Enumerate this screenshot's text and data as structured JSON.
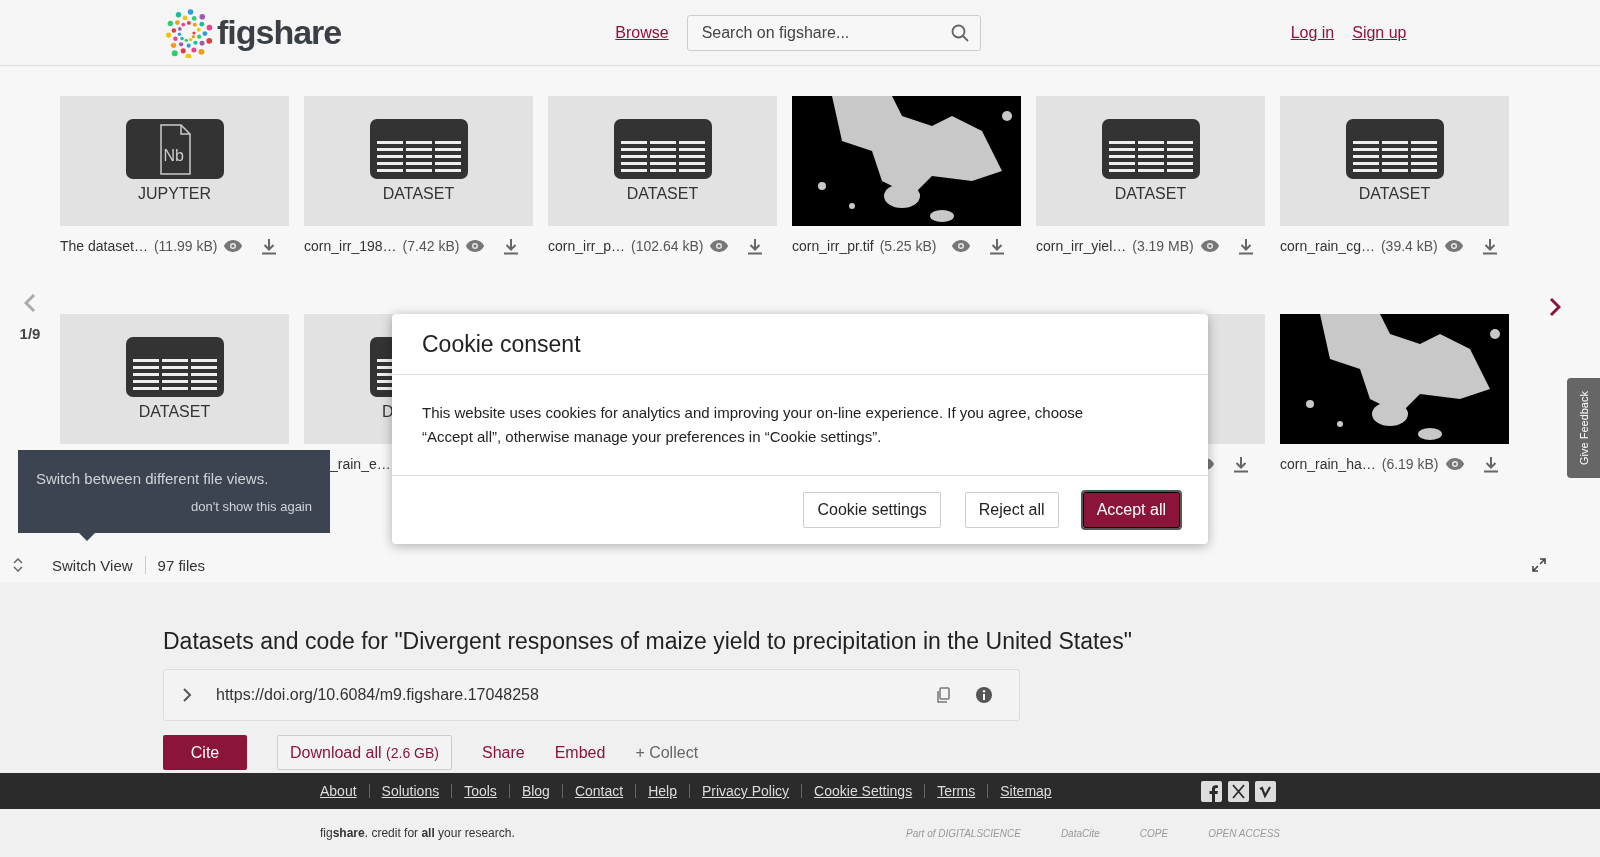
{
  "header": {
    "logo": "figshare",
    "browse": "Browse",
    "search": {
      "placeholder": "Search on figshare..."
    },
    "login": "Log in",
    "signup": "Sign up"
  },
  "viewer": {
    "page": "1/9",
    "rows": [
      [
        {
          "kind": "notebook",
          "icon_text": "Nb",
          "label": "JUPYTER",
          "name": "The dataset…",
          "size": "(11.99 kB)"
        },
        {
          "kind": "dataset",
          "label": "DATASET",
          "name": "corn_irr_198…",
          "size": "(7.42 kB)"
        },
        {
          "kind": "dataset",
          "label": "DATASET",
          "name": "corn_irr_p…",
          "size": "(102.64 kB)"
        },
        {
          "name": "corn_irr_pr.tif",
          "size": "(5.25 kB)"
        },
        {
          "kind": "dataset",
          "label": "DATASET",
          "name": "corn_irr_yiel…",
          "size": "(3.19 MB)"
        },
        {
          "kind": "dataset",
          "label": "DATASET",
          "name": "corn_rain_cg…",
          "size": "(39.4 kB)"
        }
      ],
      [
        {
          "kind": "dataset",
          "label": "DATASET"
        },
        {
          "kind": "covered",
          "label": "D",
          "name": "_rain_e…"
        },
        {
          "kind": "hidden"
        },
        {
          "kind": "hidden"
        },
        {
          "kind": "actions"
        },
        {
          "name": "corn_rain_ha…",
          "size": "(6.19 kB)"
        }
      ]
    ]
  },
  "tooltip": {
    "text": "Switch between different file views.",
    "dismiss": "don't show this again"
  },
  "view_bar": {
    "switch": "Switch View",
    "count": "97 files"
  },
  "item": {
    "title": "Datasets and code for \"Divergent responses of maize yield to precipitation in the United States\"",
    "doi": "https://doi.org/10.6084/m9.figshare.17048258",
    "actions": [
      {
        "kind": "primary",
        "label": "Cite"
      },
      {
        "kind": "outline",
        "label": "Download all",
        "note": "(2.6 GB)"
      },
      {
        "kind": "link",
        "label": "Share"
      },
      {
        "kind": "link",
        "label": "Embed"
      },
      {
        "kind": "muted",
        "label": "+ Collect"
      }
    ]
  },
  "feedback": "Give Feedback",
  "footer": {
    "links": [
      "About",
      "Solutions",
      "Tools",
      "Blog",
      "Contact",
      "Help",
      "Privacy Policy",
      "Cookie Settings",
      "Terms",
      "Sitemap"
    ],
    "tagline": "fig**share**. credit for **all** your research.",
    "partners": [
      "Part of DIGITALSCIENCE",
      "DataCite",
      "COPE",
      "OPEN ACCESS"
    ]
  },
  "modal": {
    "title": "Cookie consent",
    "body": "This website uses cookies for analytics and improving your on-line experience. If you agree, choose “Accept all”, otherwise manage your preferences in “Cookie settings”.",
    "buttons": [
      {
        "kind": "secondary",
        "label": "Cookie settings"
      },
      {
        "kind": "secondary",
        "label": "Reject all"
      },
      {
        "kind": "primary",
        "label": "Accept all"
      }
    ]
  }
}
